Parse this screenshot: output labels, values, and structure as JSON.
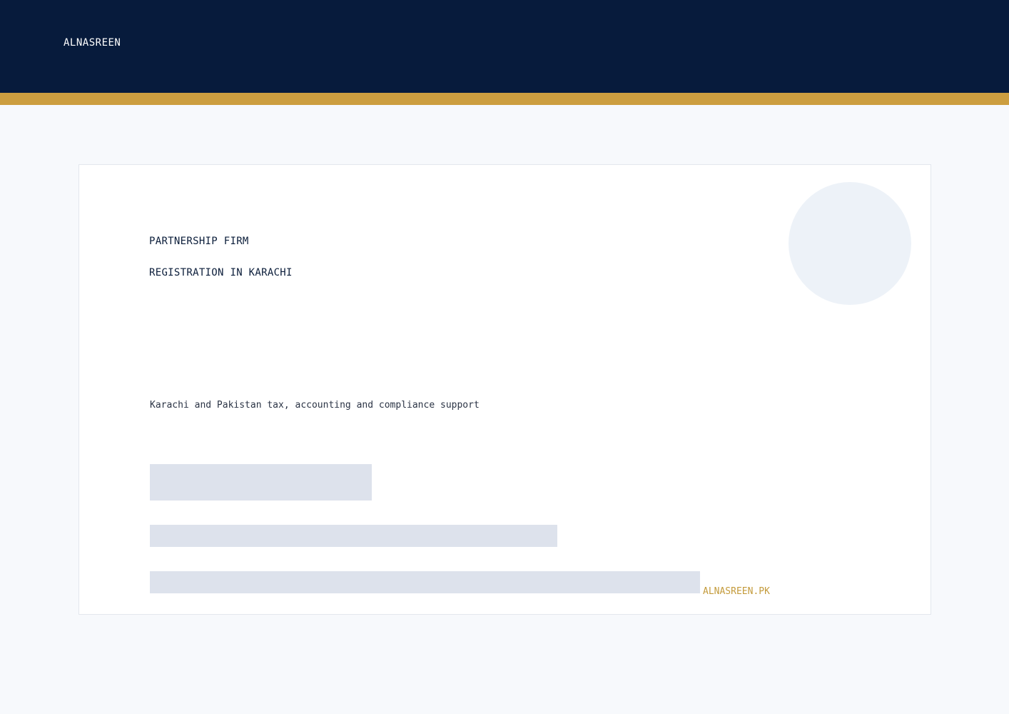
{
  "header": {
    "brand": "ALNASREEN"
  },
  "hero": {
    "title_line_1": "PARTNERSHIP FIRM",
    "title_line_2": "REGISTRATION IN KARACHI",
    "subtitle": "Karachi and Pakistan tax, accounting and compliance support",
    "domain": "ALNASREEN.PK"
  },
  "colors": {
    "header_bg": "#071b3c",
    "accent_gold": "#cc9e40",
    "page_bg": "#f7f9fc",
    "skeleton": "#dde2ec"
  }
}
